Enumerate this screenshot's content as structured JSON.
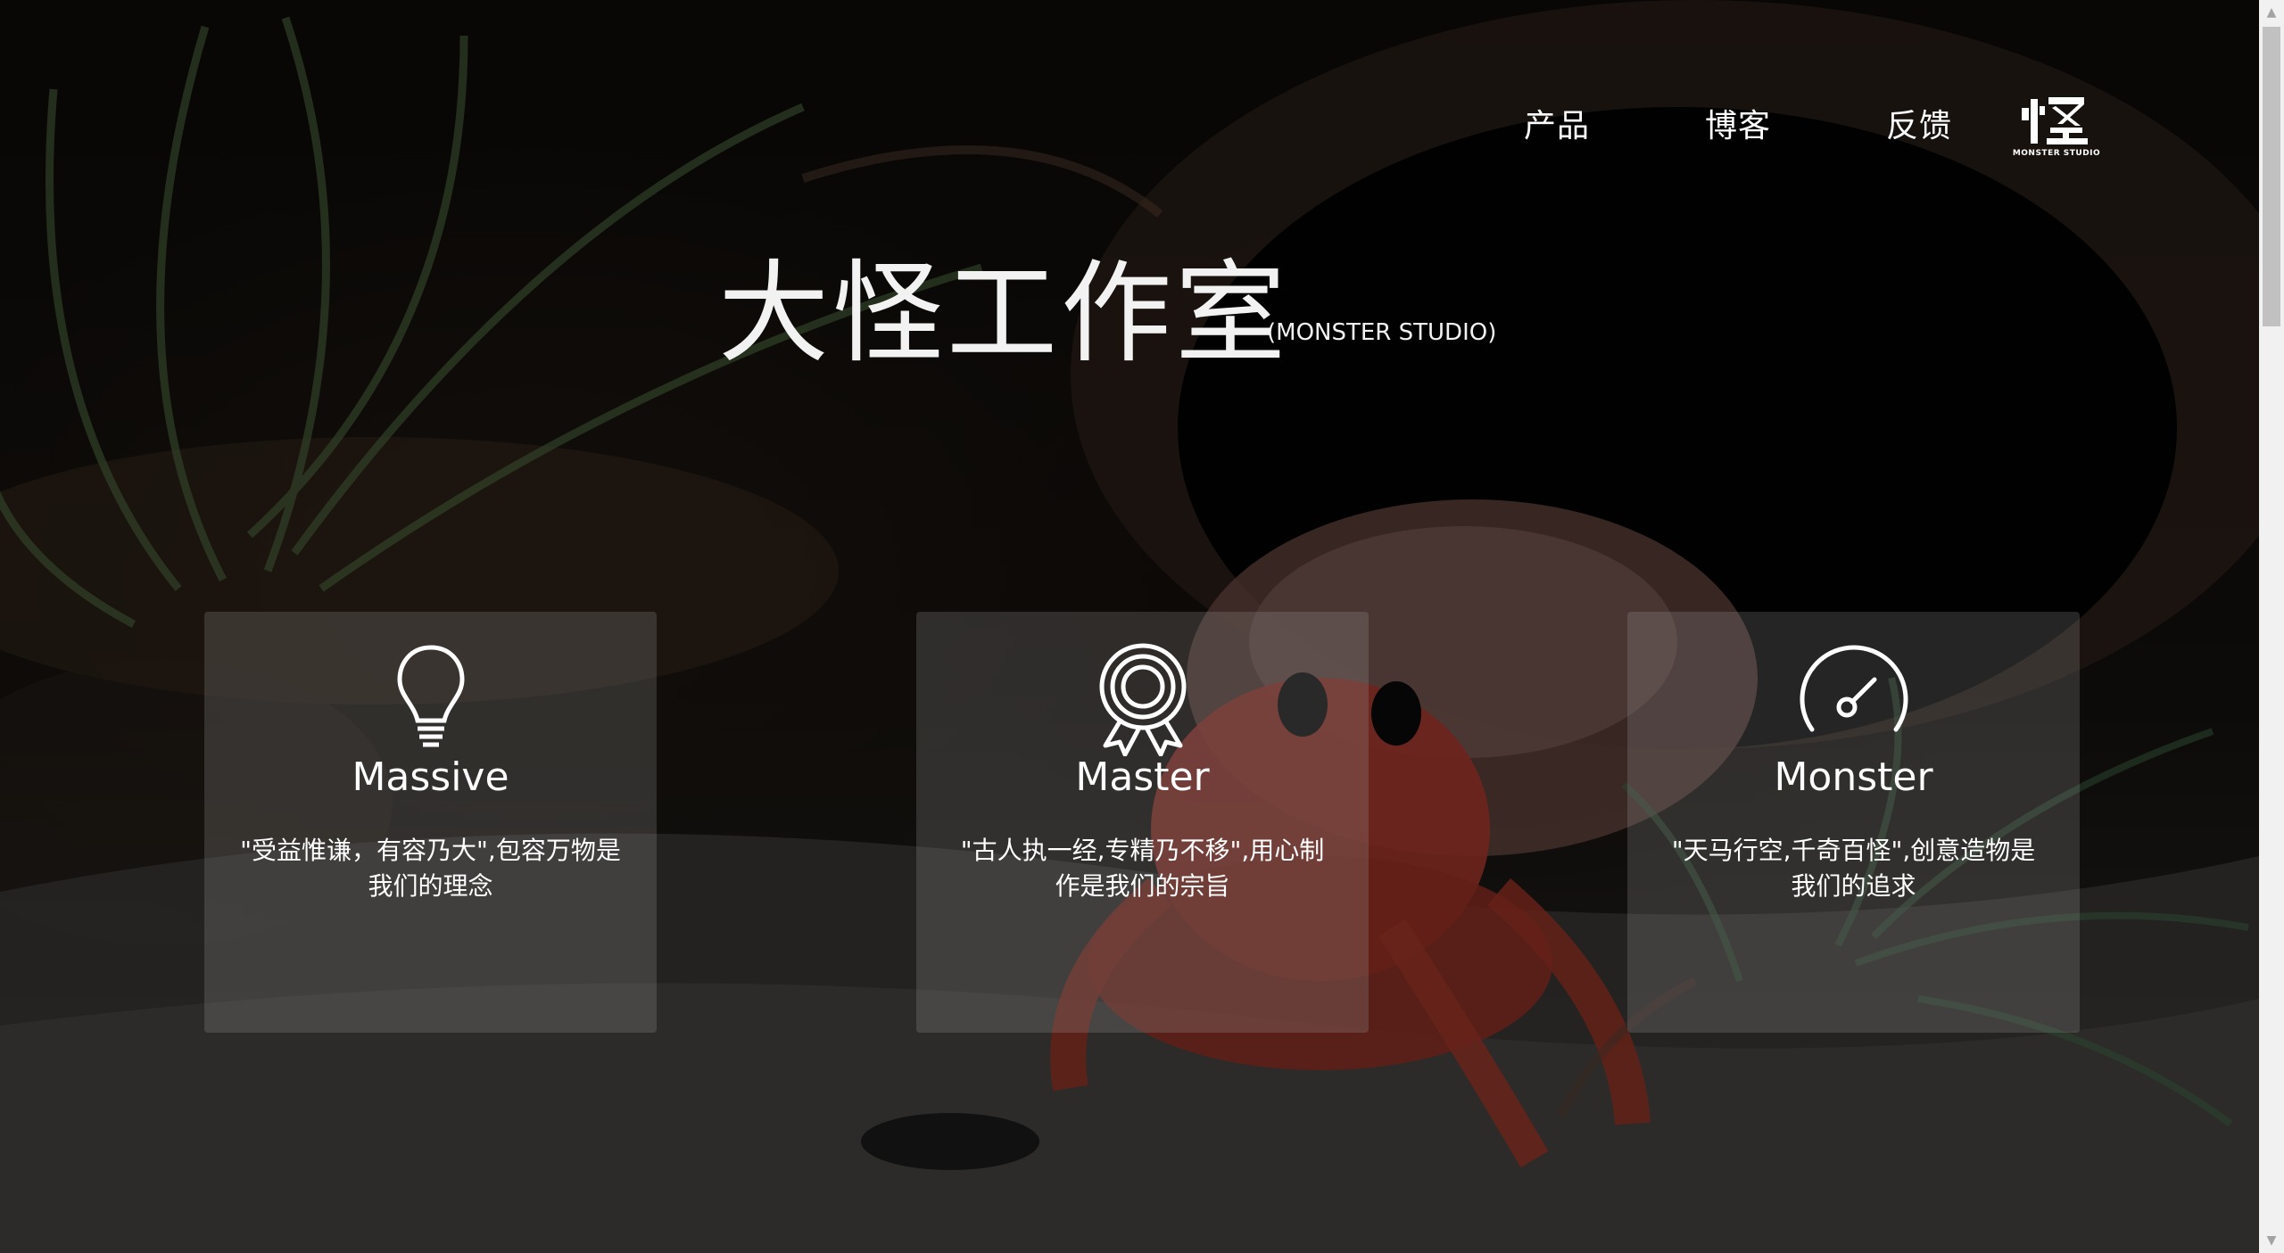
{
  "nav": {
    "items": [
      {
        "label": "产品"
      },
      {
        "label": "博客"
      },
      {
        "label": "反馈"
      }
    ],
    "logo": {
      "glyph": "怪",
      "text": "MONSTER STUDIO"
    }
  },
  "hero": {
    "title": "大怪工作室",
    "subtitle": "(MONSTER STUDIO)"
  },
  "features": [
    {
      "icon": "lightbulb-icon",
      "title": "Massive",
      "text": "\"受益惟谦，有容乃大\",包容万物是我们的理念"
    },
    {
      "icon": "award-ribbon-icon",
      "title": "Master",
      "text": "\"古人执一经,专精乃不移\",用心制作是我们的宗旨"
    },
    {
      "icon": "speedometer-icon",
      "title": "Monster",
      "text": "\"天马行空,千奇百怪\",创意造物是我们的追求"
    }
  ],
  "colors": {
    "text": "#ffffff",
    "card_background": "rgba(170,170,170,0.22)",
    "page_background": "#050505"
  }
}
